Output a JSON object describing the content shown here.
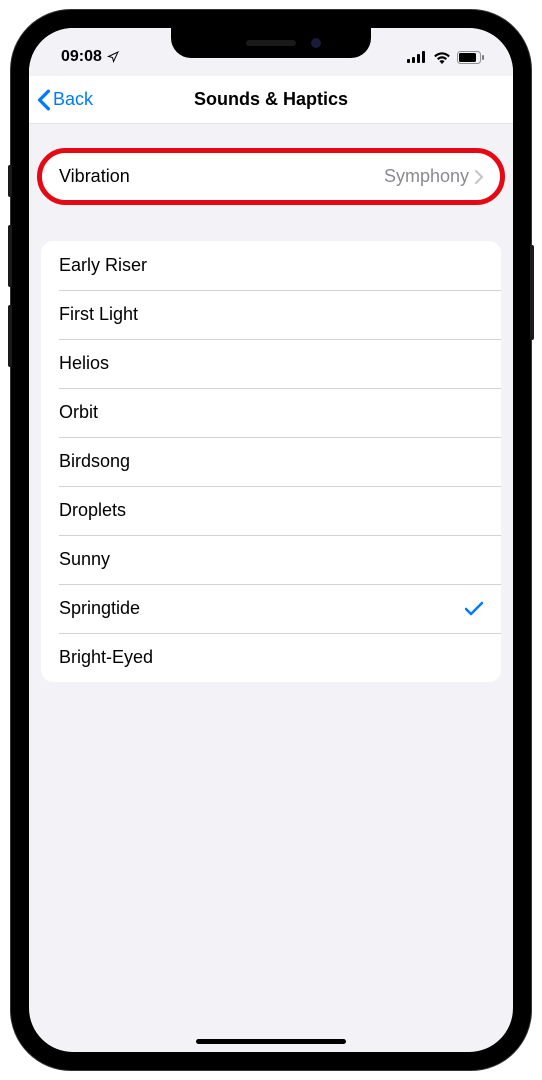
{
  "status": {
    "time": "09:08"
  },
  "nav": {
    "back_label": "Back",
    "title": "Sounds & Haptics"
  },
  "vibration": {
    "label": "Vibration",
    "value": "Symphony"
  },
  "sounds": {
    "items": [
      {
        "label": "Early Riser",
        "selected": false
      },
      {
        "label": "First Light",
        "selected": false
      },
      {
        "label": "Helios",
        "selected": false
      },
      {
        "label": "Orbit",
        "selected": false
      },
      {
        "label": "Birdsong",
        "selected": false
      },
      {
        "label": "Droplets",
        "selected": false
      },
      {
        "label": "Sunny",
        "selected": false
      },
      {
        "label": "Springtide",
        "selected": true
      },
      {
        "label": "Bright-Eyed",
        "selected": false
      }
    ]
  },
  "colors": {
    "accent": "#007aff",
    "highlight": "#e50914",
    "secondary_text": "#8a8a8e",
    "background": "#f2f2f7"
  }
}
